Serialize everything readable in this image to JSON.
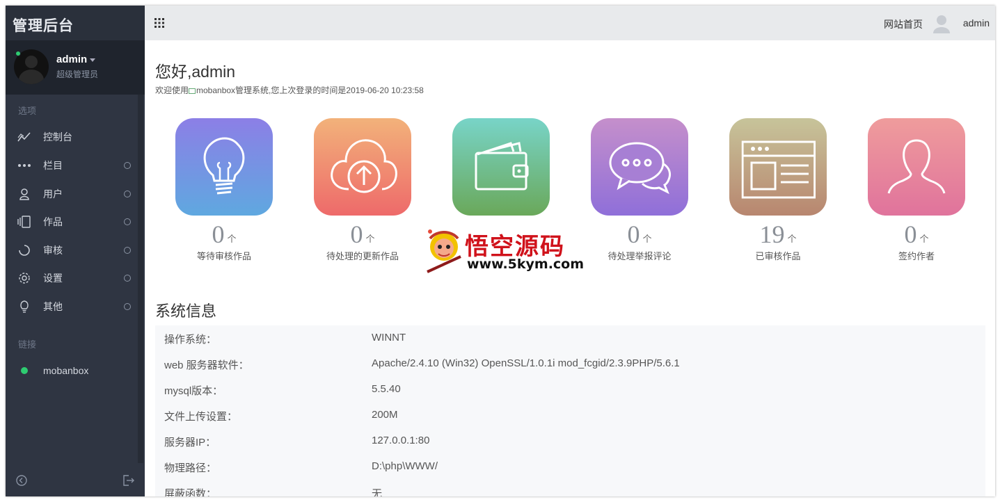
{
  "sidebar": {
    "brand": "管理后台",
    "user": {
      "name": "admin",
      "role": "超级管理员"
    },
    "section_options": "选项",
    "items": [
      {
        "label": "控制台",
        "icon": "chart-line-icon"
      },
      {
        "label": "栏目",
        "icon": "dots-icon"
      },
      {
        "label": "用户",
        "icon": "user-icon"
      },
      {
        "label": "作品",
        "icon": "files-icon"
      },
      {
        "label": "审核",
        "icon": "spinner-icon"
      },
      {
        "label": "设置",
        "icon": "gear-icon"
      },
      {
        "label": "其他",
        "icon": "lightbulb-icon"
      }
    ],
    "section_links": "链接",
    "links": [
      {
        "label": "mobanbox",
        "color": "#2ecc71"
      }
    ]
  },
  "header": {
    "home_link": "网站首页",
    "user": "admin"
  },
  "main": {
    "greeting": "您好,admin",
    "welcome_prefix": "欢迎使用",
    "welcome_rest": "mobanbox管理系统,您上次登录的时间是2019-06-20 10:23:58",
    "cards": [
      {
        "count": "0",
        "unit": "个",
        "label": "等待审核作品",
        "icon": "lightbulb-icon",
        "gradient": [
          "#8c7fe6",
          "#5fa8e0"
        ]
      },
      {
        "count": "0",
        "unit": "个",
        "label": "待处理的更新作品",
        "icon": "cloud-upload-icon",
        "gradient": [
          "#f2b27a",
          "#ee6a6a"
        ]
      },
      {
        "count": "",
        "unit": "",
        "label": "",
        "icon": "wallet-icon",
        "gradient": [
          "#78d4c8",
          "#6aa85a"
        ]
      },
      {
        "count": "0",
        "unit": "个",
        "label": "待处理举报评论",
        "icon": "chat-icon",
        "gradient": [
          "#c58fcb",
          "#8f6fd9"
        ]
      },
      {
        "count": "19",
        "unit": "个",
        "label": "已审核作品",
        "icon": "browser-window-icon",
        "gradient": [
          "#c7c49a",
          "#b8866f"
        ]
      },
      {
        "count": "0",
        "unit": "个",
        "label": "签约作者",
        "icon": "person-icon",
        "gradient": [
          "#ef9c9c",
          "#e0739c"
        ]
      }
    ],
    "watermark": {
      "title": "悟空源码",
      "url": "www.5kym.com"
    },
    "sysinfo_title": "系统信息",
    "sysinfo": [
      {
        "key": "操作系统：",
        "value": "WINNT"
      },
      {
        "key": "web 服务器软件：",
        "value": "Apache/2.4.10 (Win32) OpenSSL/1.0.1i mod_fcgid/2.3.9PHP/5.6.1"
      },
      {
        "key": "mysql版本：",
        "value": "5.5.40"
      },
      {
        "key": "文件上传设置：",
        "value": "200M"
      },
      {
        "key": "服务器IP：",
        "value": "127.0.0.1:80"
      },
      {
        "key": "物理路径：",
        "value": "D:\\php\\WWW/"
      },
      {
        "key": "屏蔽函数：",
        "value": "无"
      }
    ]
  }
}
